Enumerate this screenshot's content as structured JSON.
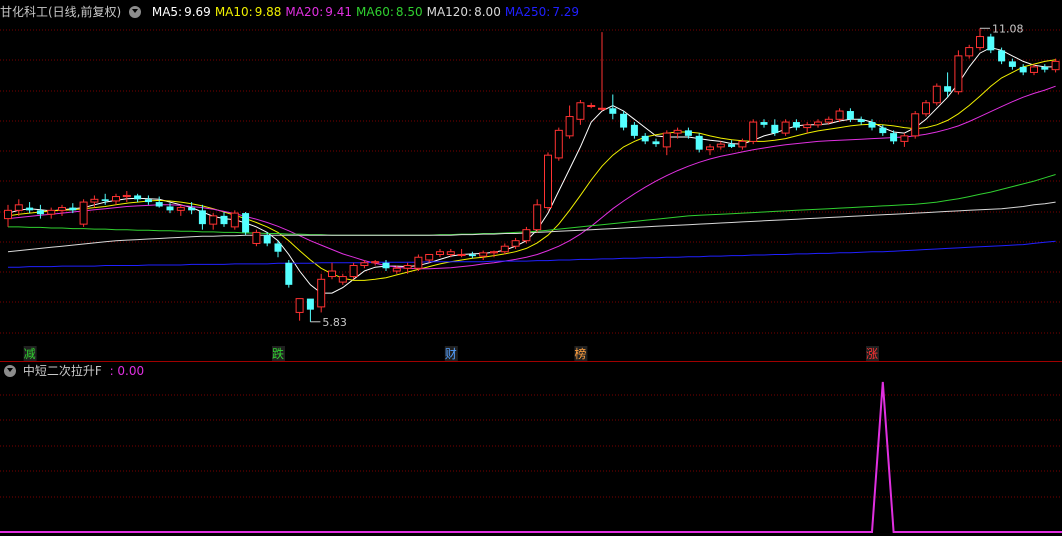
{
  "header": {
    "stock_name": "甘化科工(日线,前复权)",
    "ma_items": [
      {
        "label": "MA5:",
        "value": "9.69",
        "color": "#ffffff"
      },
      {
        "label": "MA10:",
        "value": "9.88",
        "color": "#f0f000"
      },
      {
        "label": "MA20:",
        "value": "9.41",
        "color": "#e030e0"
      },
      {
        "label": "MA60:",
        "value": "8.50",
        "color": "#30d030"
      },
      {
        "label": "MA120:",
        "value": "8.00",
        "color": "#d8d8d8"
      },
      {
        "label": "MA250:",
        "value": "7.29",
        "color": "#2020ff"
      }
    ]
  },
  "indicator": {
    "name": "中短二次拉升F",
    "value": ": 0.00",
    "color": "#e030e0"
  },
  "colors": {
    "up": "#ff3232",
    "down": "#54ffff",
    "grid": "#7a0000",
    "separator": "#a00000"
  },
  "chart_data": {
    "type": "candlestick",
    "price_range": [
      5.5,
      11.3
    ],
    "max_label": "11.08",
    "min_label": "5.83",
    "candles": [
      [
        7.7,
        7.95,
        7.55,
        7.85
      ],
      [
        7.85,
        8.05,
        7.75,
        7.95
      ],
      [
        7.9,
        8.0,
        7.8,
        7.85
      ],
      [
        7.85,
        7.95,
        7.7,
        7.78
      ],
      [
        7.78,
        7.9,
        7.7,
        7.85
      ],
      [
        7.85,
        7.95,
        7.75,
        7.9
      ],
      [
        7.9,
        7.98,
        7.8,
        7.85
      ],
      [
        7.6,
        8.05,
        7.55,
        8.0
      ],
      [
        8.0,
        8.12,
        7.9,
        8.05
      ],
      [
        8.05,
        8.15,
        7.95,
        8.02
      ],
      [
        8.02,
        8.15,
        7.95,
        8.1
      ],
      [
        8.1,
        8.2,
        8.0,
        8.12
      ],
      [
        8.12,
        8.15,
        8.0,
        8.05
      ],
      [
        8.05,
        8.12,
        7.95,
        8.0
      ],
      [
        8.0,
        8.1,
        7.9,
        7.92
      ],
      [
        7.92,
        7.98,
        7.8,
        7.85
      ],
      [
        7.85,
        7.95,
        7.75,
        7.9
      ],
      [
        7.9,
        8.0,
        7.78,
        7.85
      ],
      [
        7.85,
        7.95,
        7.5,
        7.6
      ],
      [
        7.6,
        7.8,
        7.5,
        7.75
      ],
      [
        7.75,
        7.82,
        7.55,
        7.6
      ],
      [
        7.55,
        7.85,
        7.5,
        7.8
      ],
      [
        7.8,
        7.82,
        7.4,
        7.45
      ],
      [
        7.25,
        7.5,
        7.2,
        7.45
      ],
      [
        7.4,
        7.45,
        7.2,
        7.25
      ],
      [
        7.25,
        7.3,
        7.0,
        7.1
      ],
      [
        6.9,
        6.95,
        6.45,
        6.5
      ],
      [
        6.0,
        6.25,
        5.85,
        6.25
      ],
      [
        6.25,
        6.2,
        5.83,
        6.05
      ],
      [
        6.1,
        6.7,
        6.0,
        6.6
      ],
      [
        6.65,
        6.9,
        6.6,
        6.75
      ],
      [
        6.55,
        6.7,
        6.5,
        6.65
      ],
      [
        6.65,
        6.9,
        6.6,
        6.85
      ],
      [
        6.85,
        6.95,
        6.8,
        6.9
      ],
      [
        6.9,
        6.95,
        6.85,
        6.92
      ],
      [
        6.9,
        6.95,
        6.75,
        6.8
      ],
      [
        6.75,
        6.85,
        6.7,
        6.8
      ],
      [
        6.8,
        6.9,
        6.7,
        6.85
      ],
      [
        6.8,
        7.05,
        6.75,
        7.0
      ],
      [
        6.95,
        7.05,
        6.9,
        7.05
      ],
      [
        7.05,
        7.15,
        7.0,
        7.1
      ],
      [
        7.05,
        7.15,
        7.0,
        7.1
      ],
      [
        7.05,
        7.15,
        7.0,
        7.05
      ],
      [
        7.05,
        7.1,
        6.98,
        7.02
      ],
      [
        7.02,
        7.12,
        6.95,
        7.08
      ],
      [
        7.08,
        7.12,
        7.0,
        7.1
      ],
      [
        7.1,
        7.25,
        7.05,
        7.2
      ],
      [
        7.2,
        7.35,
        7.15,
        7.3
      ],
      [
        7.3,
        7.55,
        7.25,
        7.5
      ],
      [
        7.5,
        8.05,
        7.45,
        7.95
      ],
      [
        7.9,
        8.9,
        7.85,
        8.85
      ],
      [
        8.8,
        9.35,
        8.75,
        9.3
      ],
      [
        9.2,
        9.75,
        9.15,
        9.55
      ],
      [
        9.5,
        9.85,
        9.4,
        9.8
      ],
      [
        9.75,
        9.8,
        9.7,
        9.75
      ],
      [
        9.7,
        11.08,
        9.65,
        9.7
      ],
      [
        9.7,
        9.95,
        9.5,
        9.6
      ],
      [
        9.6,
        9.65,
        9.3,
        9.35
      ],
      [
        9.4,
        9.45,
        9.15,
        9.2
      ],
      [
        9.2,
        9.25,
        9.05,
        9.1
      ],
      [
        9.1,
        9.15,
        9.0,
        9.05
      ],
      [
        9.0,
        9.3,
        8.85,
        9.25
      ],
      [
        9.25,
        9.35,
        9.15,
        9.3
      ],
      [
        9.3,
        9.35,
        9.15,
        9.2
      ],
      [
        9.2,
        9.25,
        8.9,
        8.95
      ],
      [
        8.95,
        9.05,
        8.85,
        9.0
      ],
      [
        9.0,
        9.1,
        8.95,
        9.05
      ],
      [
        9.05,
        9.12,
        8.98,
        9.0
      ],
      [
        9.0,
        9.15,
        8.95,
        9.1
      ],
      [
        9.1,
        9.5,
        9.05,
        9.45
      ],
      [
        9.45,
        9.5,
        9.35,
        9.4
      ],
      [
        9.4,
        9.5,
        9.2,
        9.25
      ],
      [
        9.25,
        9.5,
        9.2,
        9.45
      ],
      [
        9.45,
        9.5,
        9.3,
        9.35
      ],
      [
        9.35,
        9.45,
        9.25,
        9.4
      ],
      [
        9.4,
        9.5,
        9.35,
        9.45
      ],
      [
        9.45,
        9.55,
        9.4,
        9.5
      ],
      [
        9.5,
        9.7,
        9.45,
        9.65
      ],
      [
        9.65,
        9.7,
        9.45,
        9.5
      ],
      [
        9.5,
        9.55,
        9.4,
        9.45
      ],
      [
        9.45,
        9.5,
        9.3,
        9.35
      ],
      [
        9.35,
        9.4,
        9.2,
        9.25
      ],
      [
        9.25,
        9.3,
        9.05,
        9.1
      ],
      [
        9.1,
        9.25,
        9.0,
        9.2
      ],
      [
        9.2,
        9.65,
        9.15,
        9.6
      ],
      [
        9.6,
        9.85,
        9.55,
        9.8
      ],
      [
        9.8,
        10.15,
        9.75,
        10.1
      ],
      [
        10.1,
        10.35,
        9.9,
        10.0
      ],
      [
        10.0,
        10.75,
        9.95,
        10.65
      ],
      [
        10.65,
        10.85,
        10.6,
        10.8
      ],
      [
        10.8,
        11.15,
        10.75,
        11.0
      ],
      [
        11.0,
        11.05,
        10.7,
        10.75
      ],
      [
        10.75,
        10.8,
        10.5,
        10.55
      ],
      [
        10.55,
        10.6,
        10.4,
        10.45
      ],
      [
        10.45,
        10.5,
        10.3,
        10.35
      ],
      [
        10.35,
        10.5,
        10.3,
        10.45
      ],
      [
        10.45,
        10.5,
        10.35,
        10.4
      ],
      [
        10.4,
        10.6,
        10.35,
        10.55
      ]
    ],
    "ma_lines": [
      {
        "name": "MA5",
        "color": "#ffffff",
        "values": [
          7.8,
          7.85,
          7.88,
          7.86,
          7.84,
          7.86,
          7.88,
          7.9,
          7.95,
          8.0,
          8.03,
          8.06,
          8.07,
          8.06,
          8.05,
          8.0,
          7.95,
          7.9,
          7.82,
          7.74,
          7.7,
          7.68,
          7.62,
          7.55,
          7.45,
          7.3,
          7.05,
          6.75,
          6.5,
          6.35,
          6.35,
          6.45,
          6.6,
          6.75,
          6.82,
          6.84,
          6.84,
          6.83,
          6.85,
          6.9,
          6.96,
          7.02,
          7.05,
          7.06,
          7.07,
          7.09,
          7.13,
          7.2,
          7.3,
          7.5,
          7.8,
          8.2,
          8.6,
          9.0,
          9.45,
          9.65,
          9.75,
          9.65,
          9.5,
          9.35,
          9.2,
          9.18,
          9.18,
          9.18,
          9.15,
          9.12,
          9.1,
          9.06,
          9.05,
          9.12,
          9.2,
          9.25,
          9.32,
          9.38,
          9.4,
          9.4,
          9.42,
          9.47,
          9.5,
          9.5,
          9.45,
          9.35,
          9.27,
          9.25,
          9.35,
          9.5,
          9.7,
          9.9,
          10.15,
          10.45,
          10.7,
          10.8,
          10.75,
          10.65,
          10.55,
          10.48,
          10.45,
          10.45
        ]
      },
      {
        "name": "MA10",
        "color": "#f0f000",
        "values": [
          7.75,
          7.78,
          7.8,
          7.82,
          7.84,
          7.85,
          7.86,
          7.88,
          7.9,
          7.92,
          7.95,
          7.98,
          8.0,
          8.02,
          8.03,
          8.02,
          8.0,
          7.97,
          7.93,
          7.88,
          7.82,
          7.76,
          7.7,
          7.63,
          7.55,
          7.45,
          7.3,
          7.12,
          6.95,
          6.8,
          6.7,
          6.62,
          6.58,
          6.58,
          6.6,
          6.63,
          6.68,
          6.73,
          6.78,
          6.83,
          6.88,
          6.92,
          6.95,
          6.98,
          7.0,
          7.03,
          7.06,
          7.1,
          7.16,
          7.26,
          7.4,
          7.6,
          7.85,
          8.12,
          8.4,
          8.65,
          8.85,
          9.0,
          9.1,
          9.18,
          9.22,
          9.25,
          9.27,
          9.27,
          9.25,
          9.2,
          9.16,
          9.13,
          9.11,
          9.1,
          9.1,
          9.12,
          9.15,
          9.2,
          9.25,
          9.29,
          9.32,
          9.35,
          9.38,
          9.4,
          9.41,
          9.4,
          9.38,
          9.35,
          9.33,
          9.35,
          9.4,
          9.48,
          9.6,
          9.75,
          9.92,
          10.1,
          10.25,
          10.35,
          10.45,
          10.5,
          10.55,
          10.58
        ]
      },
      {
        "name": "MA20",
        "color": "#e030e0",
        "values": [
          7.7,
          7.72,
          7.74,
          7.76,
          7.78,
          7.8,
          7.82,
          7.84,
          7.86,
          7.88,
          7.9,
          7.92,
          7.93,
          7.94,
          7.95,
          7.95,
          7.94,
          7.92,
          7.9,
          7.87,
          7.83,
          7.79,
          7.74,
          7.69,
          7.63,
          7.56,
          7.48,
          7.39,
          7.3,
          7.22,
          7.14,
          7.06,
          7.0,
          6.94,
          6.89,
          6.85,
          6.82,
          6.8,
          6.79,
          6.79,
          6.8,
          6.81,
          6.83,
          6.85,
          6.88,
          6.9,
          6.93,
          6.96,
          7.0,
          7.05,
          7.12,
          7.2,
          7.3,
          7.42,
          7.56,
          7.72,
          7.88,
          8.02,
          8.15,
          8.27,
          8.38,
          8.48,
          8.57,
          8.65,
          8.72,
          8.78,
          8.83,
          8.87,
          8.91,
          8.95,
          8.98,
          9.01,
          9.04,
          9.06,
          9.08,
          9.1,
          9.11,
          9.12,
          9.13,
          9.14,
          9.15,
          9.16,
          9.17,
          9.18,
          9.2,
          9.23,
          9.27,
          9.32,
          9.38,
          9.46,
          9.55,
          9.64,
          9.73,
          9.82,
          9.9,
          9.97,
          10.03,
          10.1
        ]
      },
      {
        "name": "MA60",
        "color": "#30d030",
        "values": [
          7.55,
          7.55,
          7.54,
          7.54,
          7.53,
          7.53,
          7.52,
          7.52,
          7.51,
          7.51,
          7.5,
          7.5,
          7.49,
          7.49,
          7.48,
          7.48,
          7.47,
          7.47,
          7.46,
          7.46,
          7.45,
          7.45,
          7.44,
          7.44,
          7.43,
          7.43,
          7.42,
          7.42,
          7.41,
          7.41,
          7.4,
          7.4,
          7.4,
          7.4,
          7.4,
          7.4,
          7.4,
          7.4,
          7.4,
          7.4,
          7.41,
          7.41,
          7.42,
          7.42,
          7.43,
          7.43,
          7.44,
          7.45,
          7.46,
          7.47,
          7.49,
          7.51,
          7.53,
          7.55,
          7.57,
          7.59,
          7.61,
          7.63,
          7.65,
          7.67,
          7.69,
          7.71,
          7.73,
          7.75,
          7.76,
          7.77,
          7.78,
          7.79,
          7.8,
          7.81,
          7.82,
          7.83,
          7.84,
          7.85,
          7.86,
          7.87,
          7.88,
          7.89,
          7.9,
          7.91,
          7.92,
          7.93,
          7.94,
          7.95,
          7.96,
          7.98,
          8.0,
          8.03,
          8.06,
          8.1,
          8.14,
          8.18,
          8.23,
          8.28,
          8.33,
          8.38,
          8.44,
          8.5
        ]
      },
      {
        "name": "MA120",
        "color": "#d8d8d8",
        "values": [
          7.1,
          7.12,
          7.14,
          7.16,
          7.18,
          7.2,
          7.22,
          7.24,
          7.26,
          7.28,
          7.3,
          7.31,
          7.32,
          7.33,
          7.34,
          7.35,
          7.36,
          7.37,
          7.38,
          7.38,
          7.39,
          7.39,
          7.4,
          7.4,
          7.4,
          7.4,
          7.4,
          7.4,
          7.4,
          7.4,
          7.4,
          7.4,
          7.4,
          7.4,
          7.4,
          7.4,
          7.4,
          7.4,
          7.4,
          7.4,
          7.4,
          7.4,
          7.41,
          7.41,
          7.42,
          7.42,
          7.43,
          7.43,
          7.44,
          7.45,
          7.46,
          7.47,
          7.48,
          7.49,
          7.5,
          7.51,
          7.52,
          7.53,
          7.54,
          7.55,
          7.56,
          7.57,
          7.58,
          7.59,
          7.6,
          7.61,
          7.62,
          7.63,
          7.64,
          7.65,
          7.66,
          7.67,
          7.68,
          7.69,
          7.7,
          7.71,
          7.72,
          7.73,
          7.74,
          7.75,
          7.76,
          7.77,
          7.78,
          7.79,
          7.8,
          7.81,
          7.82,
          7.83,
          7.84,
          7.85,
          7.86,
          7.87,
          7.88,
          7.9,
          7.92,
          7.95,
          7.97,
          8.0
        ]
      },
      {
        "name": "MA250",
        "color": "#2020ff",
        "values": [
          6.82,
          6.82,
          6.83,
          6.83,
          6.83,
          6.84,
          6.84,
          6.84,
          6.84,
          6.85,
          6.85,
          6.85,
          6.85,
          6.86,
          6.86,
          6.86,
          6.86,
          6.87,
          6.87,
          6.87,
          6.87,
          6.88,
          6.88,
          6.88,
          6.88,
          6.89,
          6.89,
          6.89,
          6.89,
          6.9,
          6.9,
          6.9,
          6.9,
          6.9,
          6.91,
          6.91,
          6.91,
          6.91,
          6.91,
          6.92,
          6.92,
          6.92,
          6.92,
          6.92,
          6.92,
          6.93,
          6.93,
          6.93,
          6.93,
          6.94,
          6.94,
          6.95,
          6.95,
          6.96,
          6.96,
          6.97,
          6.97,
          6.98,
          6.98,
          6.99,
          6.99,
          7.0,
          7.0,
          7.01,
          7.01,
          7.02,
          7.02,
          7.03,
          7.03,
          7.04,
          7.04,
          7.05,
          7.05,
          7.06,
          7.06,
          7.07,
          7.07,
          7.08,
          7.08,
          7.09,
          7.1,
          7.1,
          7.11,
          7.12,
          7.13,
          7.14,
          7.15,
          7.16,
          7.17,
          7.18,
          7.19,
          7.2,
          7.21,
          7.22,
          7.23,
          7.25,
          7.27,
          7.29
        ]
      }
    ],
    "event_markers": [
      {
        "index": 2,
        "label": "减",
        "color": "#30d030"
      },
      {
        "index": 25,
        "label": "跌",
        "color": "#30d030"
      },
      {
        "index": 41,
        "label": "财",
        "color": "#54a0ff"
      },
      {
        "index": 53,
        "label": "榜",
        "color": "#ffa040"
      },
      {
        "index": 80,
        "label": "涨",
        "color": "#ff3232"
      }
    ],
    "indicator_values": [
      0,
      0,
      0,
      0,
      0,
      0,
      0,
      0,
      0,
      0,
      0,
      0,
      0,
      0,
      0,
      0,
      0,
      0,
      0,
      0,
      0,
      0,
      0,
      0,
      0,
      0,
      0,
      0,
      0,
      0,
      0,
      0,
      0,
      0,
      0,
      0,
      0,
      0,
      0,
      0,
      0,
      0,
      0,
      0,
      0,
      0,
      0,
      0,
      0,
      0,
      0,
      0,
      0,
      0,
      0,
      0,
      0,
      0,
      0,
      0,
      0,
      0,
      0,
      0,
      0,
      0,
      0,
      0,
      0,
      0,
      0,
      0,
      0,
      0,
      0,
      0,
      0,
      0,
      0,
      0,
      0,
      1,
      0,
      0,
      0,
      0,
      0,
      0,
      0,
      0,
      0,
      0,
      0,
      0,
      0,
      0,
      0,
      0
    ]
  }
}
